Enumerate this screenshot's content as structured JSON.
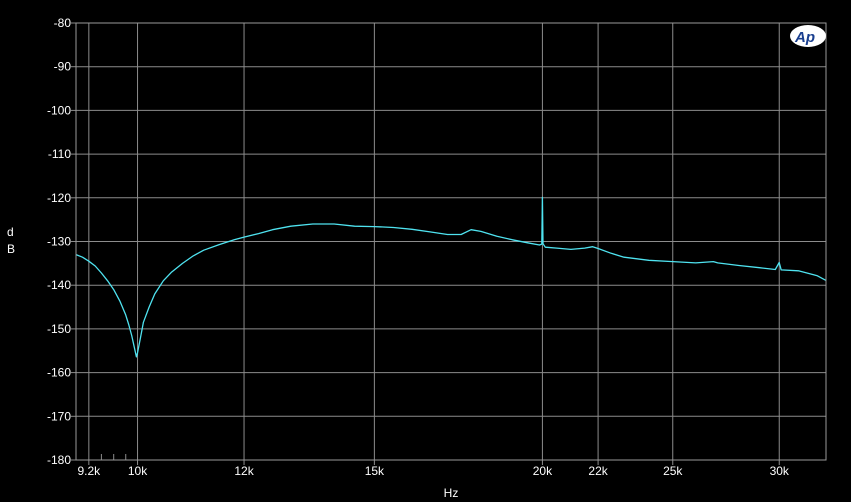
{
  "chart_data": {
    "type": "line",
    "title": "",
    "xlabel": "Hz",
    "ylabel": "dB",
    "x_scale": "log",
    "xlim": [
      9000,
      32500
    ],
    "ylim": [
      -180,
      -80
    ],
    "grid": true,
    "x_ticks": [
      {
        "value": 9200,
        "label": "9.2k"
      },
      {
        "value": 10000,
        "label": "10k"
      },
      {
        "value": 12000,
        "label": "12k"
      },
      {
        "value": 15000,
        "label": "15k"
      },
      {
        "value": 20000,
        "label": "20k"
      },
      {
        "value": 22000,
        "label": "22k"
      },
      {
        "value": 25000,
        "label": "25k"
      },
      {
        "value": 30000,
        "label": "30k"
      }
    ],
    "y_ticks": [
      {
        "value": -80,
        "label": "-80"
      },
      {
        "value": -90,
        "label": "-90"
      },
      {
        "value": -100,
        "label": "-100"
      },
      {
        "value": -110,
        "label": "-110"
      },
      {
        "value": -120,
        "label": "-120"
      },
      {
        "value": -130,
        "label": "-130"
      },
      {
        "value": -140,
        "label": "-140"
      },
      {
        "value": -150,
        "label": "-150"
      },
      {
        "value": -160,
        "label": "-160"
      },
      {
        "value": -170,
        "label": "-170"
      },
      {
        "value": -180,
        "label": "-180"
      }
    ],
    "minor_x_ticks": [
      9400,
      9600,
      9800
    ],
    "colors": {
      "background": "#000000",
      "grid": "#8c8c8c",
      "trace": "#4fe3f0",
      "text": "#ffffff",
      "logo": "#1a3f8f"
    },
    "series": [
      {
        "points": [
          [
            9000,
            -133.0
          ],
          [
            9100,
            -133.6
          ],
          [
            9200,
            -134.5
          ],
          [
            9300,
            -135.6
          ],
          [
            9400,
            -137.2
          ],
          [
            9500,
            -139.0
          ],
          [
            9600,
            -141.0
          ],
          [
            9700,
            -143.6
          ],
          [
            9800,
            -146.8
          ],
          [
            9850,
            -149.0
          ],
          [
            9900,
            -151.5
          ],
          [
            9950,
            -154.5
          ],
          [
            9980,
            -156.4
          ],
          [
            10000,
            -155.5
          ],
          [
            10050,
            -152.0
          ],
          [
            10100,
            -148.5
          ],
          [
            10200,
            -145.0
          ],
          [
            10300,
            -142.0
          ],
          [
            10450,
            -139.0
          ],
          [
            10600,
            -137.0
          ],
          [
            10800,
            -135.0
          ],
          [
            11000,
            -133.3
          ],
          [
            11200,
            -132.0
          ],
          [
            11500,
            -130.7
          ],
          [
            11800,
            -129.6
          ],
          [
            12000,
            -129.0
          ],
          [
            12300,
            -128.2
          ],
          [
            12600,
            -127.3
          ],
          [
            13000,
            -126.5
          ],
          [
            13500,
            -126.0
          ],
          [
            14000,
            -126.0
          ],
          [
            14500,
            -126.5
          ],
          [
            15000,
            -126.6
          ],
          [
            15500,
            -126.8
          ],
          [
            16000,
            -127.2
          ],
          [
            16500,
            -127.8
          ],
          [
            17000,
            -128.4
          ],
          [
            17400,
            -128.4
          ],
          [
            17700,
            -127.3
          ],
          [
            18000,
            -127.7
          ],
          [
            18500,
            -128.8
          ],
          [
            19000,
            -129.6
          ],
          [
            19500,
            -130.3
          ],
          [
            19900,
            -130.8
          ],
          [
            19980,
            -130.6
          ],
          [
            20000,
            -119.9
          ],
          [
            20020,
            -130.5
          ],
          [
            20100,
            -131.3
          ],
          [
            20500,
            -131.5
          ],
          [
            21000,
            -131.8
          ],
          [
            21500,
            -131.5
          ],
          [
            21800,
            -131.2
          ],
          [
            22000,
            -131.6
          ],
          [
            22500,
            -132.7
          ],
          [
            23000,
            -133.6
          ],
          [
            24000,
            -134.3
          ],
          [
            25000,
            -134.6
          ],
          [
            26000,
            -134.9
          ],
          [
            26800,
            -134.6
          ],
          [
            27000,
            -134.9
          ],
          [
            28000,
            -135.5
          ],
          [
            29000,
            -136.0
          ],
          [
            29800,
            -136.4
          ],
          [
            30000,
            -134.8
          ],
          [
            30100,
            -136.5
          ],
          [
            31000,
            -136.7
          ],
          [
            32000,
            -137.8
          ],
          [
            32500,
            -138.9
          ]
        ]
      }
    ]
  }
}
